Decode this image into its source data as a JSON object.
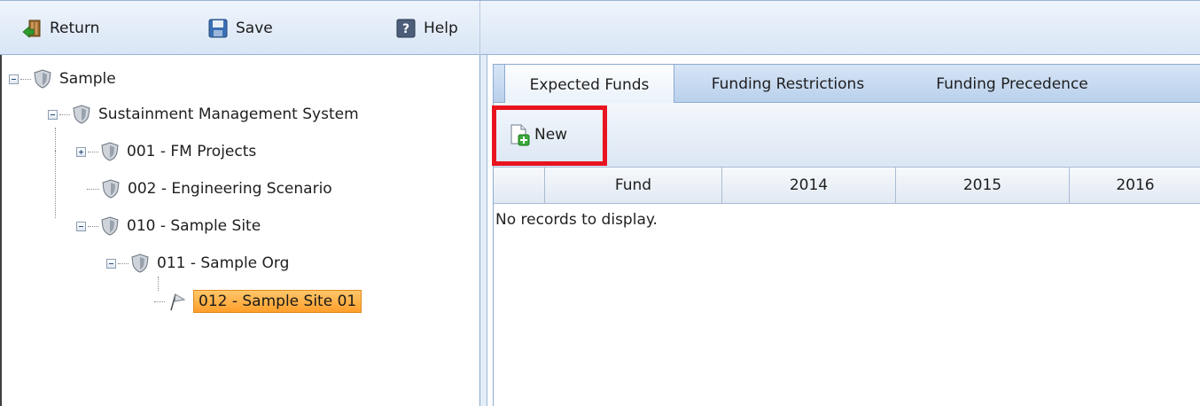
{
  "toolbar": {
    "return_label": "Return",
    "save_label": "Save",
    "help_label": "Help"
  },
  "tree": {
    "nodes": [
      {
        "label": "Sample",
        "expander": "minus"
      },
      {
        "label": "Sustainment Management System",
        "expander": "minus"
      },
      {
        "label": "001 - FM Projects",
        "expander": "plus"
      },
      {
        "label": "002 - Engineering Scenario",
        "expander": "none"
      },
      {
        "label": "010 - Sample Site",
        "expander": "minus"
      },
      {
        "label": "011 - Sample Org",
        "expander": "minus"
      },
      {
        "label": "012 - Sample Site 01",
        "expander": "none",
        "selected": true
      }
    ]
  },
  "tabs": [
    {
      "label": "Expected Funds",
      "active": true
    },
    {
      "label": "Funding Restrictions",
      "active": false
    },
    {
      "label": "Funding Precedence",
      "active": false
    }
  ],
  "grid": {
    "new_label": "New",
    "columns": [
      "",
      "Fund",
      "2014",
      "2015",
      "2016"
    ],
    "empty_message": "No records to display."
  },
  "colors": {
    "selection": "#ff9f2a",
    "highlight_box": "#e8141f",
    "accent": "#8eaad0"
  }
}
